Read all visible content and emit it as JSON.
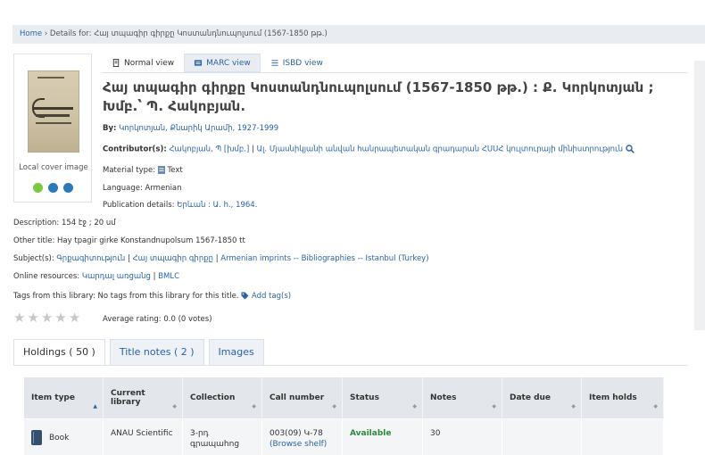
{
  "breadcrumb": {
    "home": "Home",
    "sep": "›",
    "details": "Details for: Հայ տպագիր գիրքը Կոստանդնուպոլսում (1567-1850 թթ.)"
  },
  "cover": {
    "label": "Local cover image",
    "dots": [
      "#7ac943",
      "#2a7ab8",
      "#2a7ab8"
    ]
  },
  "view_tabs": {
    "normal": "Normal view",
    "marc": "MARC view",
    "isbd": "ISBD view"
  },
  "record": {
    "title": "Հայ տպագիր գիրքը Կոստանդնուպոլսում (1567-1850 թթ.) : Ք. Կորկոտյան ; Խմբ.՝ Պ. Հակոբյան.",
    "by_label": "By:",
    "by_value": "Կորկոտյան, Քնարիկ Արամի, 1927-1999",
    "contrib_label": "Contributor(s):",
    "contrib_1": "Հակոբյան, Պ [խմբ.]",
    "contrib_sep": "|",
    "contrib_2": "Ալ. Մյասնիկյանի անվան հանրապետական գրադարան ՀՍՍՀ կուլտուրայի մինիստրություն",
    "material_label": "Material type:",
    "material_value": "Text",
    "language_label": "Language:",
    "language_value": "Armenian",
    "pub_label": "Publication details:",
    "pub_value": "Երևան : Ա. հ., 1964.",
    "desc_label": "Description:",
    "desc_value": "154 էջ ; 20 սմ",
    "other_label": "Other title:",
    "other_value": "Hay tpagir girke Konstandnupolsum 1567-1850 tt",
    "subjects_label": "Subject(s):",
    "subject_1": "Գրքագիտություն",
    "subject_2": "Հայ տպագիր գիրքը",
    "subject_3": "Armenian imprints -- Bibliographies -- Istanbul (Turkey)",
    "online_label": "Online resources:",
    "online_1": "Կարդալ առցանց",
    "online_2": "BMLC",
    "tags_label": "Tags from this library:",
    "tags_value": "No tags from this library for this title.",
    "add_tag": "Add tag(s)",
    "rating": "Average rating: 0.0 (0 votes)"
  },
  "holdings_tabs": {
    "holdings": "Holdings ( 50 )",
    "notes": "Title notes ( 2 )",
    "images": "Images"
  },
  "table": {
    "headers": [
      "Item type",
      "Current library",
      "Collection",
      "Call number",
      "Status",
      "Notes",
      "Date due",
      "Item holds"
    ],
    "row": {
      "item_type": "Book",
      "library": "ANAU Scientific",
      "collection": "3-րդ գրապահոց",
      "call_number": "003(09) Կ-78",
      "browse": "(Browse shelf)",
      "status": "Available",
      "notes": "30",
      "date_due": "",
      "holds": ""
    }
  }
}
